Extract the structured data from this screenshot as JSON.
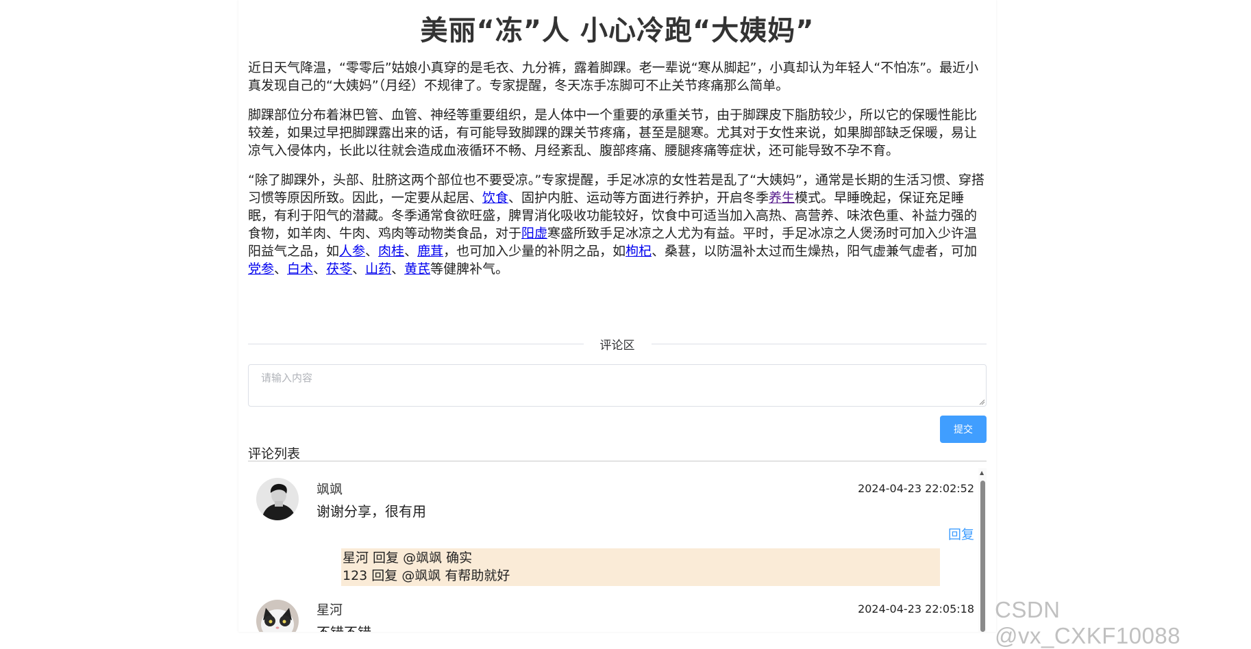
{
  "article": {
    "title": "美丽“冻”人 小心冷跑“大姨妈”",
    "p1": "近日天气降温，“零零后”姑娘小真穿的是毛衣、九分裤，露着脚踝。老一辈说“寒从脚起”，小真却认为年轻人“不怕冻”。最近小真发现自己的“大姨妈”（月经）不规律了。专家提醒，冬天冻手冻脚可不止关节疼痛那么简单。",
    "p2": "脚踝部位分布着淋巴管、血管、神经等重要组织，是人体中一个重要的承重关节，由于脚踝皮下脂肪较少，所以它的保暖性能比较差，如果过早把脚踝露出来的话，有可能导致脚踝的踝关节疼痛，甚至是腿寒。尤其对于女性来说，如果脚部缺乏保暖，易让凉气入侵体内，长此以往就会造成血液循环不畅、月经紊乱、腹部疼痛、腰腿疼痛等症状，还可能导致不孕不育。",
    "p3": {
      "t1": "“除了脚踝外，头部、肚脐这两个部位也不要受凉。”专家提醒，手足冰凉的女性若是乱了“大姨妈”，通常是长期的生活习惯、穿搭习惯等原因所致。因此，一定要从起居、",
      "link_yinshi": "饮食",
      "t2": "、固护内脏、运动等方面进行养护，开启冬季",
      "link_yangsheng": "养生",
      "t3": "模式。早睡晚起，保证充足睡眠，有利于阳气的潜藏。冬季通常食欲旺盛，脾胃消化吸收功能较好，饮食中可适当加入高热、高营养、味浓色重、补益力强的食物，如羊肉、牛肉、鸡肉等动物类食品，对于",
      "link_yangxu": "阳虚",
      "t4": "寒盛所致手足冰凉之人尤为有益。平时，手足冰凉之人煲汤时可加入少许温阳益气之品，如",
      "link_renshen": "人参",
      "sep1": "、",
      "link_rougui": "肉桂",
      "sep2": "、",
      "link_lurong": "鹿茸",
      "t5": "，也可加入少量的补阴之品，如",
      "link_gouqi": "枸杞",
      "t6": "、桑葚，以防温补太过而生燥热，阳气虚兼气虚者，可加",
      "link_dangshen": "党参",
      "sep3": "、",
      "link_baizhu": "白术",
      "sep4": "、",
      "link_fuling": "茯苓",
      "sep5": "、",
      "link_shanyao": "山药",
      "sep6": "、",
      "link_huangqi": "黄芪",
      "t7": "等健脾补气。"
    }
  },
  "comments_section": {
    "divider_label": "评论区",
    "input_placeholder": "请输入内容",
    "submit_label": "提交",
    "list_title": "评论列表",
    "items": [
      {
        "author": "飒飒",
        "time": "2024-04-23 22:02:52",
        "content": "谢谢分享，很有用",
        "reply_label": "回复",
        "replies": [
          "星河 回复 @飒飒 确实",
          "123 回复 @飒飒 有帮助就好"
        ]
      },
      {
        "author": "星河",
        "time": "2024-04-23 22:05:18",
        "content": "不错不错"
      }
    ]
  },
  "watermark": "CSDN @vx_CXKF10088"
}
